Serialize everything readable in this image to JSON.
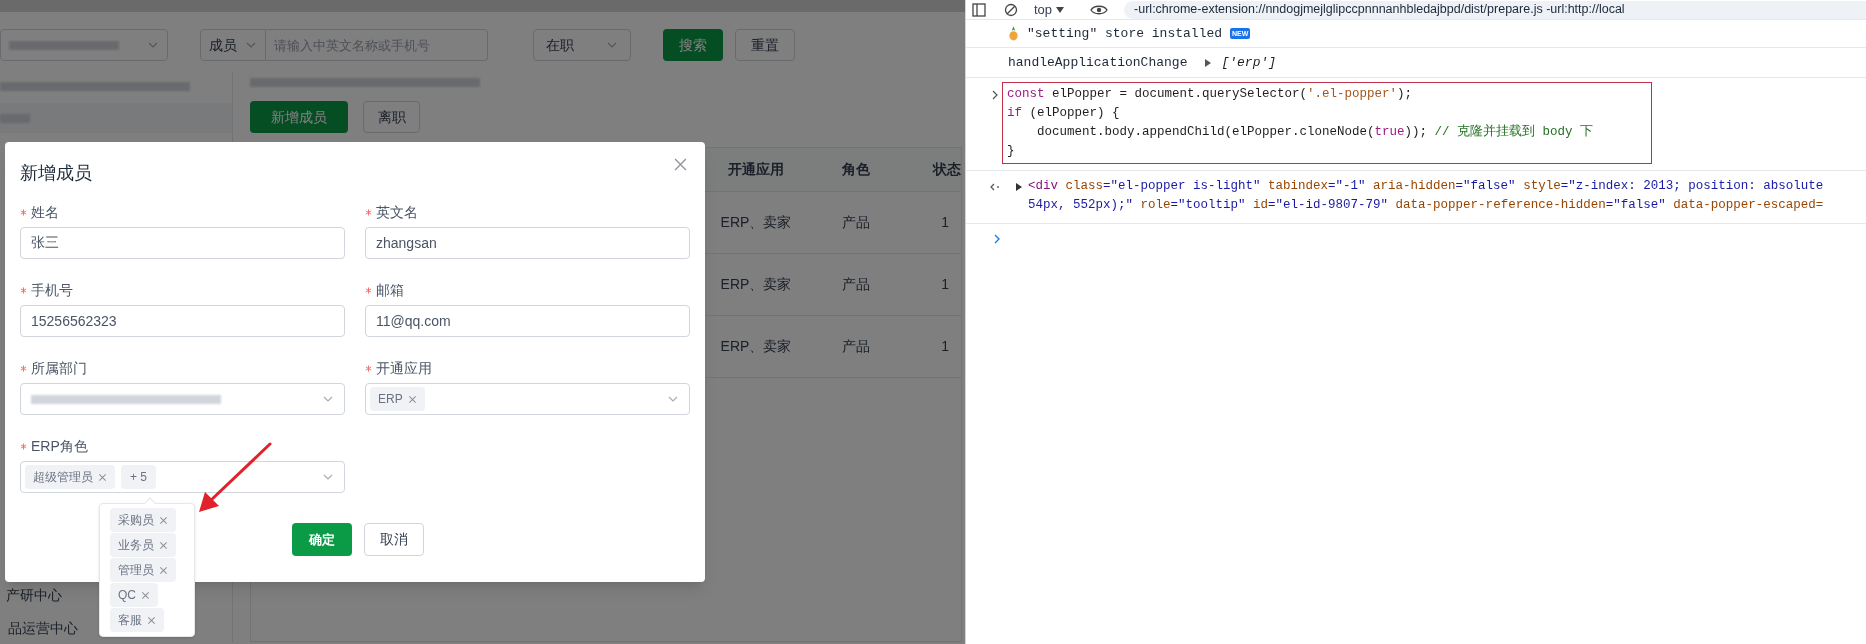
{
  "app": {
    "filters": {
      "member_type": "成员",
      "search_placeholder": "请输入中英文名称或手机号",
      "status": "在职",
      "search_button": "搜索",
      "reset_button": "重置"
    },
    "actions": [
      "新增成员",
      "离职"
    ],
    "sidebar": {
      "items": [
        "产研中心",
        "品运营中心"
      ]
    },
    "table": {
      "columns": [
        "开通应用",
        "角色",
        "状态"
      ],
      "rows": [
        [
          "ERP、卖家",
          "产品",
          "1"
        ],
        [
          "ERP、卖家",
          "产品",
          "1"
        ],
        [
          "ERP、卖家",
          "产品",
          "1"
        ]
      ]
    }
  },
  "dialog": {
    "title": "新增成员",
    "fields": [
      {
        "kind": "input",
        "label": "姓名",
        "required": true,
        "value": "张三"
      },
      {
        "kind": "input",
        "label": "英文名",
        "required": true,
        "value": "zhangsan"
      },
      {
        "kind": "input",
        "label": "手机号",
        "required": true,
        "value": "15256562323"
      },
      {
        "kind": "input",
        "label": "邮箱",
        "required": true,
        "value": "11@qq.com"
      },
      {
        "kind": "select",
        "label": "所属部门",
        "required": true
      },
      {
        "kind": "tags",
        "label": "开通应用",
        "required": true,
        "tags": [
          "ERP"
        ]
      },
      {
        "kind": "tags",
        "label": "ERP角色",
        "required": true,
        "tags": [
          "超级管理员"
        ],
        "more": "+ 5",
        "popover_tags": [
          "采购员",
          "业务员",
          "管理员",
          "QC",
          "客服"
        ]
      }
    ],
    "buttons": [
      "确定",
      "取消"
    ]
  },
  "devtools": {
    "context": "top",
    "filter": "-url:chrome-extension://nndogjmejlglipccpnnnanhbledajbpd/dist/prepare.js -url:http://local",
    "messages": [
      {
        "kind": "log",
        "text": "\"setting\" store installed",
        "badge": "NEW"
      },
      {
        "kind": "object",
        "text": "handleApplicationChange",
        "value": "['erp']"
      },
      {
        "kind": "input",
        "lines": [
          [
            {
              "text": "const",
              "kind": "keyword"
            },
            {
              "text": " elPopper = document.querySelector(",
              "kind": "plain"
            },
            {
              "text": "'.el-popper'",
              "kind": "string"
            },
            {
              "text": ");",
              "kind": "plain"
            }
          ],
          [
            {
              "text": "if",
              "kind": "keyword"
            },
            {
              "text": " (elPopper) {",
              "kind": "plain"
            }
          ],
          [
            {
              "text": "    document.body.appendChild(elPopper.cloneNode(",
              "kind": "plain"
            },
            {
              "text": "true",
              "kind": "keyword"
            },
            {
              "text": ")); ",
              "kind": "plain"
            },
            {
              "text": "// 克隆并挂载到 body 下",
              "kind": "comment"
            }
          ],
          [
            {
              "text": "}",
              "kind": "plain"
            }
          ]
        ]
      },
      {
        "kind": "result",
        "lines": [
          [
            {
              "text": "<div ",
              "kind": "tag"
            },
            {
              "text": "class",
              "kind": "attr"
            },
            {
              "text": "=\"el-popper is-light\" ",
              "kind": "value"
            },
            {
              "text": "tabindex",
              "kind": "attr"
            },
            {
              "text": "=\"-1\" ",
              "kind": "value"
            },
            {
              "text": "aria-hidden",
              "kind": "attr"
            },
            {
              "text": "=\"false\" ",
              "kind": "value"
            },
            {
              "text": "style",
              "kind": "attr"
            },
            {
              "text": "=\"z-index: 2013; position: absolute",
              "kind": "value"
            }
          ],
          [
            {
              "text": "54px, 552px);\" ",
              "kind": "value"
            },
            {
              "text": "role",
              "kind": "attr"
            },
            {
              "text": "=\"tooltip\" ",
              "kind": "value"
            },
            {
              "text": "id",
              "kind": "attr"
            },
            {
              "text": "=\"el-id-9807-79\" ",
              "kind": "value"
            },
            {
              "text": "data-popper-reference-hidden",
              "kind": "attr"
            },
            {
              "text": "=\"false\" ",
              "kind": "value"
            },
            {
              "text": "data-popper-escaped=",
              "kind": "attr"
            }
          ]
        ]
      }
    ]
  }
}
